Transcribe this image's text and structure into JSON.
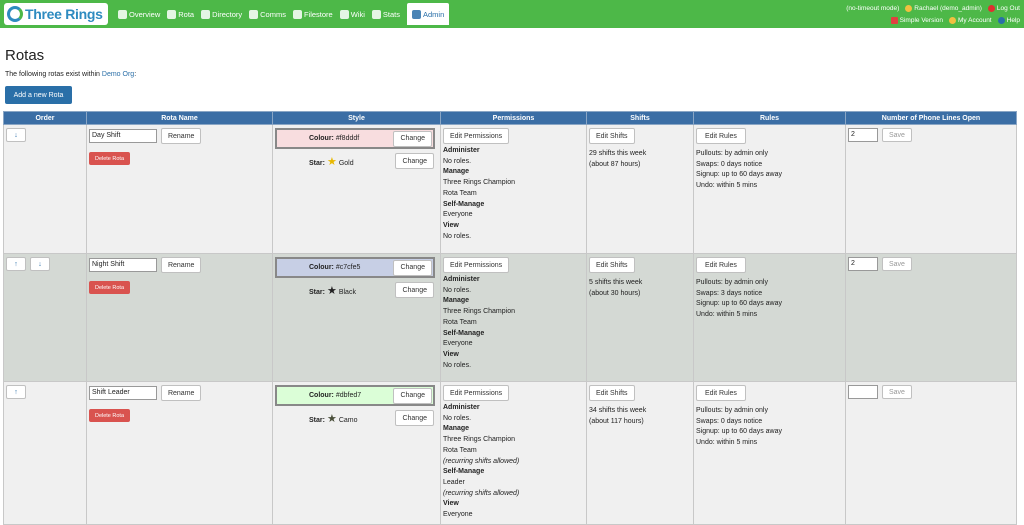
{
  "brand": "Three Rings",
  "nav": [
    {
      "label": "Overview",
      "icon": "globe-icon"
    },
    {
      "label": "Rota",
      "icon": "calendar-icon"
    },
    {
      "label": "Directory",
      "icon": "book-icon"
    },
    {
      "label": "Comms",
      "icon": "people-icon"
    },
    {
      "label": "Filestore",
      "icon": "folder-icon"
    },
    {
      "label": "Wiki",
      "icon": "globe-icon"
    },
    {
      "label": "Stats",
      "icon": "chart-icon"
    },
    {
      "label": "Admin",
      "icon": "tools-icon"
    }
  ],
  "account": {
    "mode": "(no-timeout mode)",
    "user": "Rachael (demo_admin)",
    "logout": "Log Out",
    "simple_version": "Simple Version",
    "my_account": "My Account",
    "help": "Help"
  },
  "page": {
    "title": "Rotas",
    "intro_prefix": "The following rotas exist within",
    "org": "Demo Org",
    "intro_suffix": ":",
    "add_button": "Add a new Rota"
  },
  "table": {
    "headers": [
      "Order",
      "Rota Name",
      "Style",
      "Permissions",
      "Shifts",
      "Rules",
      "Number of Phone Lines Open"
    ],
    "rows": [
      {
        "order": [
          "↓"
        ],
        "name": "Day Shift",
        "rename": "Rename",
        "delete": "Delete Rota",
        "colour_label": "Colour:",
        "colour_value": "#f8dddf",
        "colour_hex": "#f8dddf",
        "change": "Change",
        "star_label": "Star:",
        "star_value": "Gold",
        "star_color": "#e8b800",
        "edit_permissions": "Edit Permissions",
        "permissions": [
          {
            "t": "Administer",
            "s": "bold"
          },
          {
            "t": "No roles.",
            "s": ""
          },
          {
            "t": "Manage",
            "s": "bold"
          },
          {
            "t": "Three Rings Champion",
            "s": ""
          },
          {
            "t": "Rota Team",
            "s": ""
          },
          {
            "t": "Self-Manage",
            "s": "bold"
          },
          {
            "t": "Everyone",
            "s": ""
          },
          {
            "t": "View",
            "s": "bold"
          },
          {
            "t": "No roles.",
            "s": ""
          }
        ],
        "edit_shifts": "Edit Shifts",
        "shifts": [
          "29 shifts this week",
          "(about 87 hours)"
        ],
        "edit_rules": "Edit Rules",
        "rules": [
          "Pullouts: by admin only",
          "Swaps: 0 days notice",
          "Signup: up to 60 days away",
          "Undo: within 5 mins"
        ],
        "phone_lines": "2",
        "save": "Save"
      },
      {
        "order": [
          "↑",
          "↓"
        ],
        "name": "Night Shift",
        "rename": "Rename",
        "delete": "Delete Rota",
        "colour_label": "Colour:",
        "colour_value": "#c7cfe5",
        "colour_hex": "#c7cfe5",
        "change": "Change",
        "star_label": "Star:",
        "star_value": "Black",
        "star_color": "#222222",
        "edit_permissions": "Edit Permissions",
        "permissions": [
          {
            "t": "Administer",
            "s": "bold"
          },
          {
            "t": "No roles.",
            "s": ""
          },
          {
            "t": "Manage",
            "s": "bold"
          },
          {
            "t": "Three Rings Champion",
            "s": ""
          },
          {
            "t": "Rota Team",
            "s": ""
          },
          {
            "t": "Self-Manage",
            "s": "bold"
          },
          {
            "t": "Everyone",
            "s": ""
          },
          {
            "t": "View",
            "s": "bold"
          },
          {
            "t": "No roles.",
            "s": ""
          }
        ],
        "edit_shifts": "Edit Shifts",
        "shifts": [
          "5 shifts this week",
          "(about 30 hours)"
        ],
        "edit_rules": "Edit Rules",
        "rules": [
          "Pullouts: by admin only",
          "Swaps: 3 days notice",
          "Signup: up to 60 days away",
          "Undo: within 5 mins"
        ],
        "phone_lines": "2",
        "save": "Save"
      },
      {
        "order": [
          "↑"
        ],
        "name": "Shift Leader",
        "rename": "Rename",
        "delete": "Delete Rota",
        "colour_label": "Colour:",
        "colour_value": "#dbfed7",
        "colour_hex": "#dbfed7",
        "change": "Change",
        "star_label": "Star:",
        "star_value": "Camo",
        "star_color": "#4a4f3a",
        "edit_permissions": "Edit Permissions",
        "permissions": [
          {
            "t": "Administer",
            "s": "bold"
          },
          {
            "t": "No roles.",
            "s": ""
          },
          {
            "t": "Manage",
            "s": "bold"
          },
          {
            "t": "Three Rings Champion",
            "s": ""
          },
          {
            "t": "Rota Team",
            "s": ""
          },
          {
            "t": "(recurring shifts allowed)",
            "s": "it"
          },
          {
            "t": "Self-Manage",
            "s": "bold"
          },
          {
            "t": "Leader",
            "s": ""
          },
          {
            "t": "(recurring shifts allowed)",
            "s": "it"
          },
          {
            "t": "View",
            "s": "bold"
          },
          {
            "t": "Everyone",
            "s": ""
          }
        ],
        "edit_shifts": "Edit Shifts",
        "shifts": [
          "34 shifts this week",
          "(about 117 hours)"
        ],
        "edit_rules": "Edit Rules",
        "rules": [
          "Pullouts: by admin only",
          "Swaps: 0 days notice",
          "Signup: up to 60 days away",
          "Undo: within 5 mins"
        ],
        "phone_lines": "",
        "save": "Save"
      }
    ]
  }
}
